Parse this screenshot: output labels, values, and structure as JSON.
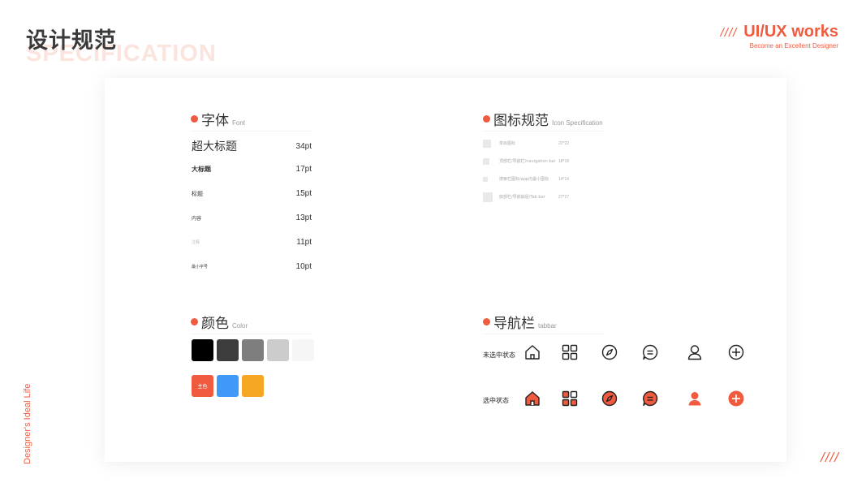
{
  "header": {
    "title_cn": "设计规范",
    "title_en": "SPECIFICATION",
    "brand_slashes": "////",
    "brand_name": "UI/UX works",
    "brand_tagline": "Become an Excellent Designer"
  },
  "side_text": "Designer's Ideal Life",
  "corner_slashes": "////",
  "colors": {
    "accent": "#f05b3f",
    "title_bg_text": "#fbe3de"
  },
  "font_section": {
    "title": "字体",
    "subtitle": "Font",
    "rows": [
      {
        "name": "超大标题",
        "size": "34pt"
      },
      {
        "name": "大标题",
        "size": "17pt"
      },
      {
        "name": "标题",
        "size": "15pt"
      },
      {
        "name": "内容",
        "size": "13pt"
      },
      {
        "name": "注释",
        "size": "11pt"
      },
      {
        "name": "最小字号",
        "size": "10pt"
      }
    ]
  },
  "icon_section": {
    "title": "图标规范",
    "subtitle": "Icon Specification",
    "rows": [
      {
        "desc": "单目图标",
        "size": "22*22"
      },
      {
        "desc": "顶部栏/导航栏/navigation bar",
        "size": "18*18"
      },
      {
        "desc": "搜索栏图标/app内最小图标",
        "size": "14*14"
      },
      {
        "desc": "底部栏/导航抽屉/Tab bar",
        "size": "27*27"
      }
    ]
  },
  "color_section": {
    "title": "颜色",
    "subtitle": "Color",
    "grays": [
      "#000000",
      "#3c3c3c",
      "#7e7e7e",
      "#cccccc",
      "#f6f6f6"
    ],
    "brand": [
      {
        "color": "#f05b3f",
        "label": "主色"
      },
      {
        "color": "#3e99f7",
        "label": ""
      },
      {
        "color": "#f5a623",
        "label": ""
      }
    ]
  },
  "tabbar_section": {
    "title": "导航栏",
    "subtitle": "tabbar",
    "unselected_label": "未选中状态",
    "selected_label": "选中状态",
    "icons": [
      "home-icon",
      "grid-icon",
      "compass-icon",
      "message-icon",
      "user-icon",
      "plus-icon"
    ]
  }
}
